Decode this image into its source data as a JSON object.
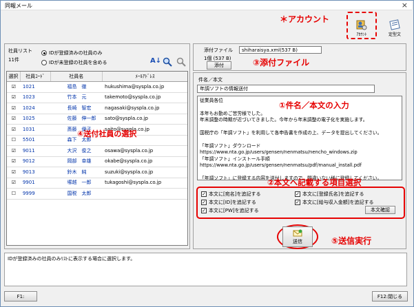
{
  "window": {
    "title": "同報メール",
    "close": "×"
  },
  "annotations": {
    "account": "＊アカウント",
    "attach": "③添付ファイル",
    "subject": "①件名／本文の入力",
    "recipients": "④送付社員の選択",
    "items": "②本文へ記載する項目選択",
    "send": "⑤送信実行"
  },
  "toolbar": {
    "account_label": "ｱｶｳﾝﾄ",
    "template_label": "定型文"
  },
  "employee_list": {
    "label": "社員リスト",
    "count": "11件",
    "radio1": "IDが登録済みの社員のみ",
    "radio2": "IDが未登録の社員を含める",
    "columns": [
      "選択",
      "社員ｺｰﾄﾞ",
      "社員名",
      "ﾒｰﾙｱﾄﾞﾚｽ"
    ],
    "rows": [
      {
        "checked": "☑",
        "code": "1021",
        "name": "福島　徹",
        "mail": "hukushima@syspla.co.jp"
      },
      {
        "checked": "☑",
        "code": "1023",
        "name": "竹本　元",
        "mail": "takemoto@syspla.co.jp"
      },
      {
        "checked": "☑",
        "code": "1024",
        "name": "長崎　智宏",
        "mail": "nagasaki@syspla.co.jp"
      },
      {
        "checked": "☑",
        "code": "1025",
        "name": "佐藤　伸一郎",
        "mail": "sato@syspla.co.jp"
      },
      {
        "checked": "☑",
        "code": "1031",
        "name": "斎藤　優子",
        "mail": "saito@syspla.co.jp"
      },
      {
        "checked": "☐",
        "code": "5501",
        "name": "森下　太郎",
        "mail": ""
      },
      {
        "checked": "☑",
        "code": "9011",
        "name": "大沢　俊之",
        "mail": "osawa@syspla.co.jp"
      },
      {
        "checked": "☑",
        "code": "9012",
        "name": "岡部　幸雄",
        "mail": "okabe@syspla.co.jp"
      },
      {
        "checked": "☑",
        "code": "9013",
        "name": "鈴木　純",
        "mail": "suzuki@syspla.co.jp"
      },
      {
        "checked": "☑",
        "code": "9901",
        "name": "塚越　一郎",
        "mail": "tukagoshi@syspla.co.jp"
      },
      {
        "checked": "☐",
        "code": "9999",
        "name": "国税　太郎",
        "mail": ""
      }
    ]
  },
  "attachment": {
    "label": "添付ファイル",
    "file": "shiharaisya.xml(537 B)",
    "count": "1個 (537 B)",
    "button": "添付"
  },
  "message": {
    "subject_label": "件名／本文",
    "subject": "年調ソフトの情報送付",
    "body": "従業員各位\n\n本年もお勤めご苦労様でした。\n年末調整の時期が近づいてきました。今年から年末調整の電子化を実施します。\n\n国税庁の「年調ソフト」を利用して各申告書を作成の上、データを提出してください。\n\n「年調ソフト」ダウンロード\nhttps://www.nta.go.jp/users/gensen/nenmatsu/nencho_windows.zip\n「年調ソフト」インストール手順\nhttps://www.nta.go.jp/users/gensen/nenmatsu/pdf/manual_install.pdf\n\n「年調ソフト」に登録する内容を送付しますので、間違いない様に登録してください。"
  },
  "options": {
    "opt1": "本文に[宛名]を追記する",
    "opt2": "本文に[登録氏名]を追記する",
    "opt3": "本文に[ID]を追記する",
    "opt4": "本文に[給与収入金額]を追記する",
    "opt5": "本文に[PW]を追記する",
    "confirm_button": "本文確認"
  },
  "send_button": "送信",
  "hint": "IDが登録済みの社員のみﾘｽﾄに表示する場合に選択します。",
  "footer": {
    "f1": "F1:",
    "f12": "F12:閉じる"
  }
}
